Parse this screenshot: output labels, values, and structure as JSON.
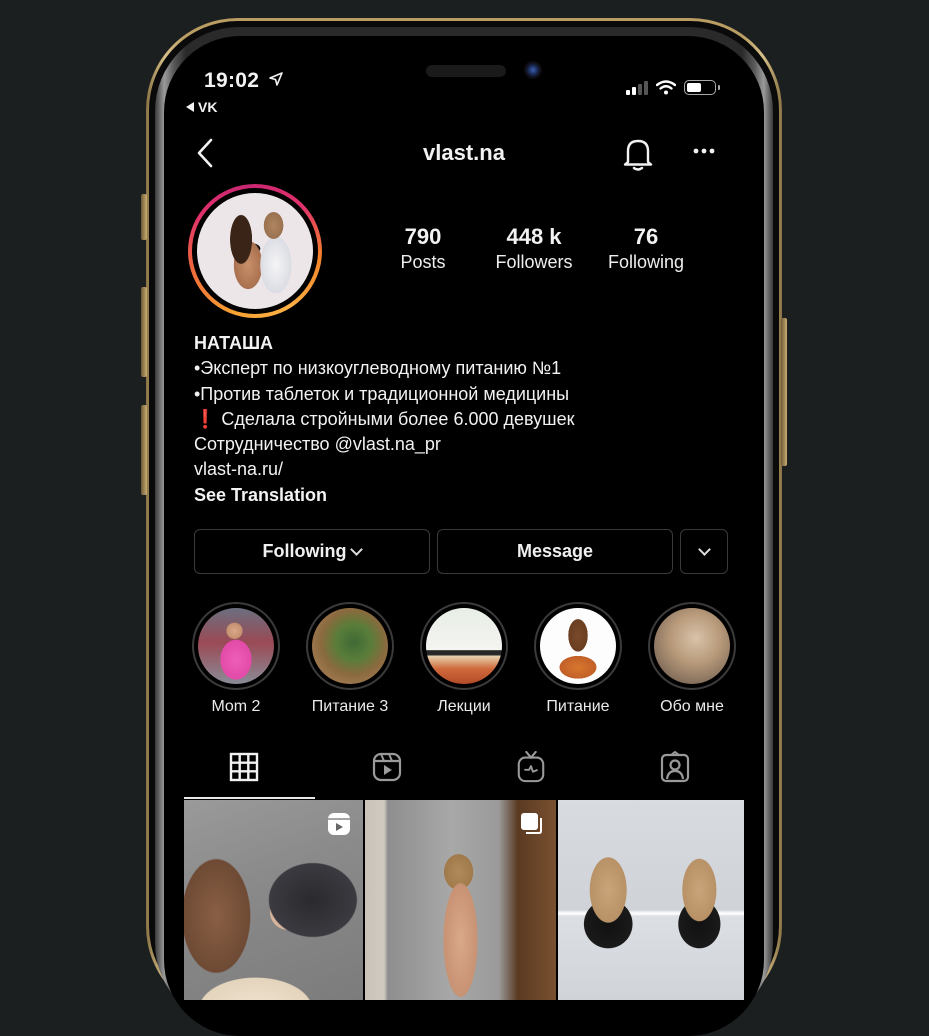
{
  "status_bar": {
    "time": "19:02",
    "back_app": "VK",
    "icons": [
      "location-arrow-icon",
      "cellular-signal-icon",
      "wifi-icon",
      "battery-icon"
    ],
    "signal_bars_active": 2,
    "signal_bars_total": 4,
    "battery_level": 0.5
  },
  "header": {
    "username": "vlast.na",
    "back_icon": "chevron-left-icon",
    "bell_icon": "bell-icon",
    "more_icon": "more-horizontal-icon"
  },
  "stats": [
    {
      "value": "790",
      "label": "Posts"
    },
    {
      "value": "448 k",
      "label": "Followers"
    },
    {
      "value": "76",
      "label": "Following"
    }
  ],
  "bio": {
    "name": "НАТАША",
    "lines": [
      "•Эксперт по низкоуглеводному питанию №1",
      "•Против таблеток и традиционной медицины"
    ],
    "highlight_prefix": "❗",
    "highlight_line": " Сделала стройными более 6.000 девушек",
    "collab_prefix": "Сотрудничество ",
    "collab_mention": "@vlast.na_pr",
    "link": "vlast-na.ru/",
    "see_translation": "See Translation"
  },
  "actions": {
    "following_label": "Following",
    "message_label": "Message"
  },
  "highlights": [
    {
      "label": "Mom 2"
    },
    {
      "label": "Питание 3"
    },
    {
      "label": "Лекции"
    },
    {
      "label": "Питание"
    },
    {
      "label": "Обо мне"
    }
  ],
  "tabs": [
    {
      "name": "posts-grid",
      "icon": "grid-icon",
      "active": true
    },
    {
      "name": "reels",
      "icon": "reels-icon",
      "active": false
    },
    {
      "name": "igtv",
      "icon": "igtv-icon",
      "active": false
    },
    {
      "name": "tagged",
      "icon": "tagged-person-icon",
      "active": false
    }
  ],
  "posts": [
    {
      "badge": "reels-icon"
    },
    {
      "badge": "carousel-icon"
    },
    {
      "badge": ""
    }
  ],
  "colors": {
    "background": "#000000",
    "text": "#f2f2f2",
    "button_border": "#3a3a3a",
    "story_ring_start": "#e1306c",
    "story_ring_end": "#fcb045",
    "frame_gold": "#b99d62",
    "exclamation": "#e0242a"
  }
}
